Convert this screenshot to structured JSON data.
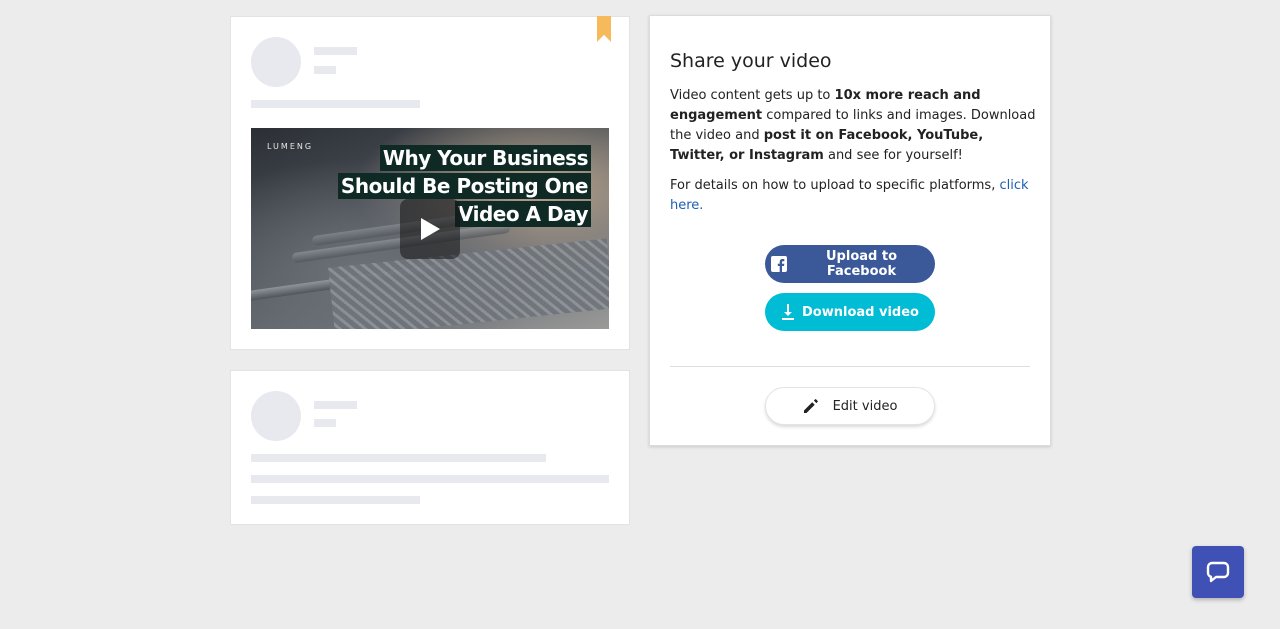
{
  "post_preview": {
    "video": {
      "brand_text": "LUMENG",
      "headline_lines": [
        "Why Your Business",
        "Should Be Posting One",
        "Video A Day"
      ],
      "play_icon": "play-icon"
    },
    "bookmark_color": "#f6b95c"
  },
  "share_panel": {
    "title": "Share your video",
    "intro": {
      "t1": "Video content gets up to ",
      "b1": "10x more reach and engagement",
      "t2": " compared to links and images. Download the video and ",
      "b2": "post it on Facebook, YouTube, Twitter, or Instagram",
      "t3": " and see for yourself!"
    },
    "details": {
      "text": "For details on how to upload to specific platforms, ",
      "link": "click here."
    },
    "upload_facebook_label": "Upload to Facebook",
    "download_video_label": "Download video",
    "edit_video_label": "Edit video"
  },
  "colors": {
    "facebook": "#3b5998",
    "download": "#00bcd4",
    "link": "#1d5fb3",
    "chat": "#3f51b5"
  },
  "icons": {
    "facebook": "facebook-icon",
    "download": "download-icon",
    "edit": "pencil-icon",
    "chat": "chat-bubble-icon"
  }
}
